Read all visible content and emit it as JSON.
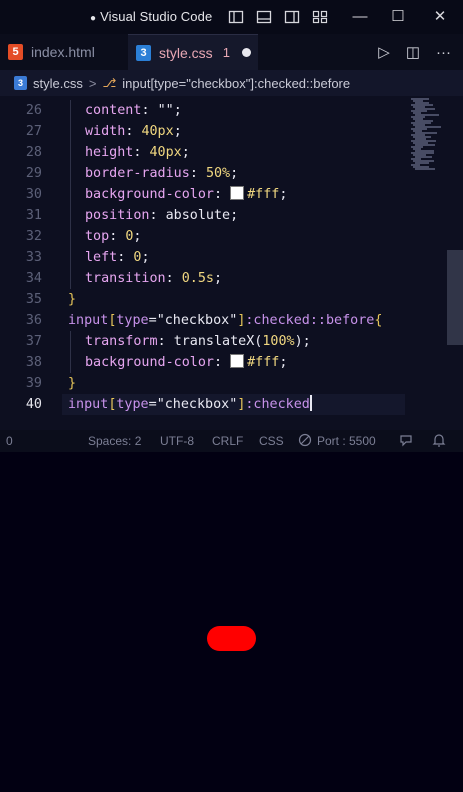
{
  "titlebar": {
    "title": "Visual Studio Code",
    "modified_marker": "●",
    "layout_icons": [
      "toggle-primary-sidebar-icon",
      "toggle-panel-icon",
      "toggle-secondary-sidebar-icon",
      "customize-layout-icon"
    ],
    "minimize": "—",
    "maximize": "☐",
    "close": "✕"
  },
  "tabs": [
    {
      "label": "index.html",
      "icon": "html-file-icon",
      "icon_text": "5",
      "icon_color": "#e44d26",
      "active": false
    },
    {
      "label": "style.css",
      "icon": "css-file-icon",
      "icon_text": "3",
      "icon_color": "#2b7fd6",
      "active": true,
      "badge": "1"
    }
  ],
  "tab_actions": {
    "run": "▷",
    "split": "◫",
    "more": "···"
  },
  "breadcrumb": {
    "file": "style.css",
    "separator": ">",
    "symbol": "input[type=\"checkbox\"]:checked::before"
  },
  "code": {
    "current_line": 40,
    "lines": [
      {
        "n": "26",
        "tokens": [
          {
            "t": "p",
            "v": "content"
          },
          {
            "t": "s",
            "v": ": "
          },
          {
            "t": "str",
            "v": "\"\""
          },
          {
            "t": "s",
            "v": ";"
          }
        ],
        "indent": 1
      },
      {
        "n": "27",
        "tokens": [
          {
            "t": "p",
            "v": "width"
          },
          {
            "t": "s",
            "v": ": "
          },
          {
            "t": "v",
            "v": "40px"
          },
          {
            "t": "s",
            "v": ";"
          }
        ],
        "indent": 1
      },
      {
        "n": "28",
        "tokens": [
          {
            "t": "p",
            "v": "height"
          },
          {
            "t": "s",
            "v": ": "
          },
          {
            "t": "v",
            "v": "40px"
          },
          {
            "t": "s",
            "v": ";"
          }
        ],
        "indent": 1
      },
      {
        "n": "29",
        "tokens": [
          {
            "t": "p",
            "v": "border-radius"
          },
          {
            "t": "s",
            "v": ": "
          },
          {
            "t": "v",
            "v": "50%"
          },
          {
            "t": "s",
            "v": ";"
          }
        ],
        "indent": 1
      },
      {
        "n": "30",
        "tokens": [
          {
            "t": "p",
            "v": "background-color"
          },
          {
            "t": "s",
            "v": ": "
          },
          {
            "t": "box",
            "v": ""
          },
          {
            "t": "v",
            "v": "#fff"
          },
          {
            "t": "s",
            "v": ";"
          }
        ],
        "indent": 1
      },
      {
        "n": "31",
        "tokens": [
          {
            "t": "p",
            "v": "position"
          },
          {
            "t": "s",
            "v": ": "
          },
          {
            "t": "s",
            "v": "absolute"
          },
          {
            "t": "s",
            "v": ";"
          }
        ],
        "indent": 1
      },
      {
        "n": "32",
        "tokens": [
          {
            "t": "p",
            "v": "top"
          },
          {
            "t": "s",
            "v": ": "
          },
          {
            "t": "v",
            "v": "0"
          },
          {
            "t": "s",
            "v": ";"
          }
        ],
        "indent": 1
      },
      {
        "n": "33",
        "tokens": [
          {
            "t": "p",
            "v": "left"
          },
          {
            "t": "s",
            "v": ": "
          },
          {
            "t": "v",
            "v": "0"
          },
          {
            "t": "s",
            "v": ";"
          }
        ],
        "indent": 1
      },
      {
        "n": "34",
        "tokens": [
          {
            "t": "p",
            "v": "transition"
          },
          {
            "t": "s",
            "v": ": "
          },
          {
            "t": "v",
            "v": "0.5s"
          },
          {
            "t": "s",
            "v": ";"
          }
        ],
        "indent": 1
      },
      {
        "n": "35",
        "tokens": [
          {
            "t": "brace",
            "v": "}"
          }
        ],
        "indent": 0
      },
      {
        "n": "36",
        "tokens": [
          {
            "t": "sel",
            "v": "input"
          },
          {
            "t": "brace",
            "v": "["
          },
          {
            "t": "attr",
            "v": "type"
          },
          {
            "t": "s",
            "v": "="
          },
          {
            "t": "str",
            "v": "\"checkbox\""
          },
          {
            "t": "brace",
            "v": "]"
          },
          {
            "t": "sel",
            "v": ":checked::before"
          },
          {
            "t": "brace",
            "v": "{"
          }
        ],
        "indent": 0
      },
      {
        "n": "37",
        "tokens": [
          {
            "t": "p",
            "v": "transform"
          },
          {
            "t": "s",
            "v": ": "
          },
          {
            "t": "s",
            "v": "translateX("
          },
          {
            "t": "v",
            "v": "100%"
          },
          {
            "t": "s",
            "v": ");"
          }
        ],
        "indent": 1
      },
      {
        "n": "38",
        "tokens": [
          {
            "t": "p",
            "v": "background-color"
          },
          {
            "t": "s",
            "v": ": "
          },
          {
            "t": "box",
            "v": ""
          },
          {
            "t": "v",
            "v": "#fff"
          },
          {
            "t": "s",
            "v": ";"
          }
        ],
        "indent": 1
      },
      {
        "n": "39",
        "tokens": [
          {
            "t": "brace",
            "v": "}"
          }
        ],
        "indent": 0
      },
      {
        "n": "40",
        "tokens": [
          {
            "t": "sel",
            "v": "input"
          },
          {
            "t": "brace",
            "v": "["
          },
          {
            "t": "attr",
            "v": "type"
          },
          {
            "t": "s",
            "v": "="
          },
          {
            "t": "str",
            "v": "\"checkbox\""
          },
          {
            "t": "brace",
            "v": "]"
          },
          {
            "t": "sel",
            "v": ":checked"
          }
        ],
        "indent": 0
      }
    ]
  },
  "statusbar": {
    "errors": "0",
    "spaces": "Spaces: 2",
    "encoding": "UTF-8",
    "eol": "CRLF",
    "language": "CSS",
    "port": "Port : 5500",
    "feedback_icon": "feedback-icon",
    "bell_icon": "bell-icon"
  },
  "preview": {
    "toggle_color": "#ff0000",
    "background": "#020012"
  }
}
